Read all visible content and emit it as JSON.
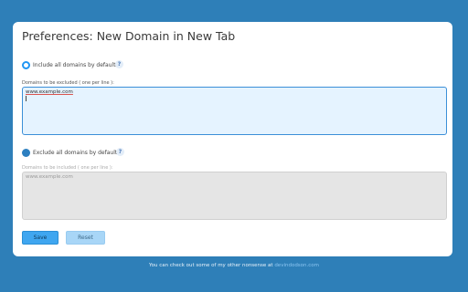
{
  "page": {
    "title": "Preferences: New Domain in New Tab"
  },
  "include_option": {
    "label": "Include all domains by default",
    "selected": true,
    "help": "?"
  },
  "excluded_field": {
    "label": "Domains to be excluded ( one per line ):",
    "value": "www.example.com"
  },
  "exclude_option": {
    "label": "Exclude all domains by default",
    "selected": false,
    "help": "?"
  },
  "included_field": {
    "label": "Domains to be included ( one per line ):",
    "placeholder": "www.example.com"
  },
  "buttons": {
    "save": "Save",
    "reset": "Reset"
  },
  "footer": {
    "text": "You can check out some of my other nonsense at ",
    "link": "devindodson.com"
  },
  "colors": {
    "background": "#2e7fb8",
    "accent": "#2196f3",
    "save_button": "#3fa6f0",
    "reset_button": "#a8d6f7"
  }
}
